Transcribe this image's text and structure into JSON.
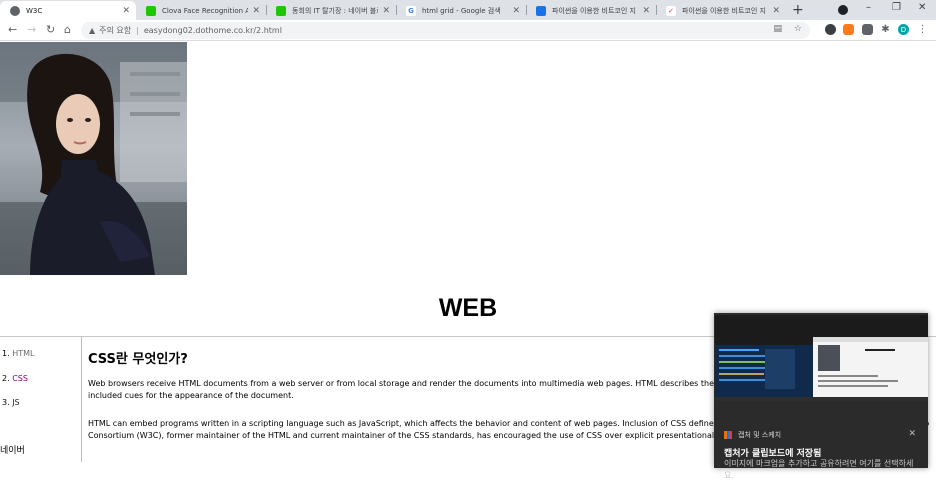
{
  "browser": {
    "tabs": [
      {
        "title": "W3C",
        "favicon": "globe-icon",
        "color": "#5f6368",
        "active": true
      },
      {
        "title": "Clova Face Recognition API : ",
        "favicon": "clova-icon",
        "color": "#1ec800",
        "active": false
      },
      {
        "title": "동희의 IT 탈기장 : 네이버 블로",
        "favicon": "naver-blog-icon",
        "color": "#1ec800",
        "active": false
      },
      {
        "title": "html grid - Google 검색",
        "favicon": "google-icon",
        "color": "#4285f4",
        "active": false
      },
      {
        "title": "파이썬을 이용한 비트코인 지",
        "favicon": "doc-icon",
        "color": "#1a73e8",
        "active": false
      },
      {
        "title": "파이썬을 이용한 비트코인 지",
        "favicon": "velog-icon",
        "color": "#e53935",
        "active": false
      }
    ],
    "new_tab": "+",
    "window_controls": {
      "minimize": "–",
      "maximize": "❐",
      "close": "✕"
    },
    "address": {
      "security_label": "주의 요함",
      "url": "easydong02.dothome.co.kr/2.html"
    }
  },
  "page": {
    "heading": "WEB",
    "nav": [
      {
        "number": "1.",
        "label": "HTML"
      },
      {
        "number": "2.",
        "label": "CSS"
      },
      {
        "number": "3.",
        "label": "JS"
      }
    ],
    "article": {
      "title": "CSS란 무엇인가?",
      "paragraph1": "Web browsers receive HTML documents from a web server or from local storage and render the documents into multimedia web pages. HTML describes the structure of a web page semantically and originally included cues for the appearance of the document.",
      "paragraph2": "HTML can embed programs written in a scripting language such as JavaScript, which affects the behavior and content of web pages. Inclusion of CSS defines the look and layout of content. The World Wide Web Consortium (W3C), former maintainer of the HTML and current maintainer of the CSS standards, has encouraged the use of CSS over explicit presentational HTML since 1997."
    },
    "footer": "네이버"
  },
  "toast": {
    "app": "캡처 및 스케치",
    "close": "✕",
    "title": "캡처가 클립보드에 저장됨",
    "body": "이미지에 마크업을 추가하고 공유하려면 여기를 선택하세요."
  },
  "colors": {
    "tabstrip": "#dee1e6",
    "link_visited": "#800080",
    "toast_bg": "#2b2b2b"
  }
}
